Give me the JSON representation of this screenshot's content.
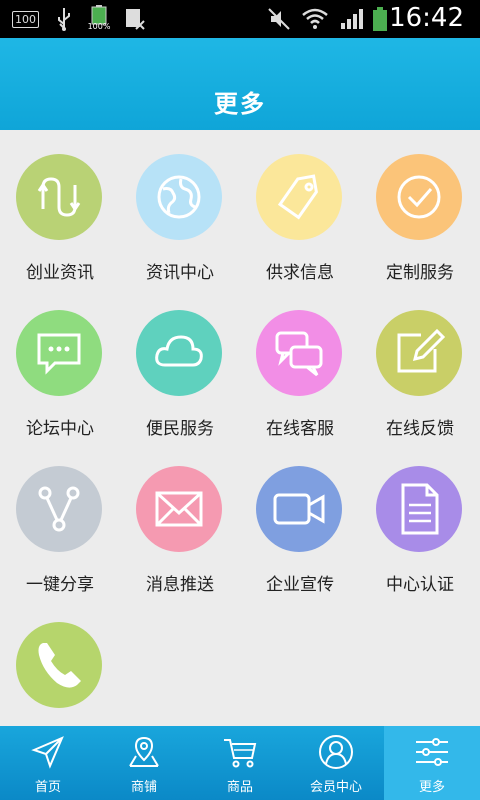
{
  "status_bar": {
    "badge_100": "100",
    "battery_percent": "100%",
    "time": "16:42"
  },
  "header": {
    "title": "更多"
  },
  "grid": {
    "items": [
      {
        "label": "创业资讯",
        "color": "#b9d275",
        "icon": "arrows-icon"
      },
      {
        "label": "资讯中心",
        "color": "#b7e2f7",
        "icon": "globe-icon"
      },
      {
        "label": "供求信息",
        "color": "#fbe79a",
        "icon": "tag-icon"
      },
      {
        "label": "定制服务",
        "color": "#fbc479",
        "icon": "check-circle-icon"
      },
      {
        "label": "论坛中心",
        "color": "#8fdc7f",
        "icon": "chat-bubble-icon"
      },
      {
        "label": "便民服务",
        "color": "#5fd1be",
        "icon": "cloud-icon"
      },
      {
        "label": "在线客服",
        "color": "#f28ee6",
        "icon": "chat-bubbles-icon"
      },
      {
        "label": "在线反馈",
        "color": "#c9cf67",
        "icon": "edit-icon"
      },
      {
        "label": "一键分享",
        "color": "#c4cbd3",
        "icon": "share-icon"
      },
      {
        "label": "消息推送",
        "color": "#f59ab1",
        "icon": "envelope-icon"
      },
      {
        "label": "企业宣传",
        "color": "#7f9fe0",
        "icon": "video-icon"
      },
      {
        "label": "中心认证",
        "color": "#a88ce8",
        "icon": "document-icon"
      },
      {
        "label": "",
        "color": "#b6d56c",
        "icon": "phone-icon"
      }
    ]
  },
  "bottom_nav": {
    "items": [
      {
        "label": "首页",
        "icon": "send-icon"
      },
      {
        "label": "商铺",
        "icon": "map-pin-icon"
      },
      {
        "label": "商品",
        "icon": "cart-icon"
      },
      {
        "label": "会员中心",
        "icon": "user-icon"
      },
      {
        "label": "更多",
        "icon": "sliders-icon",
        "active": true
      }
    ]
  }
}
